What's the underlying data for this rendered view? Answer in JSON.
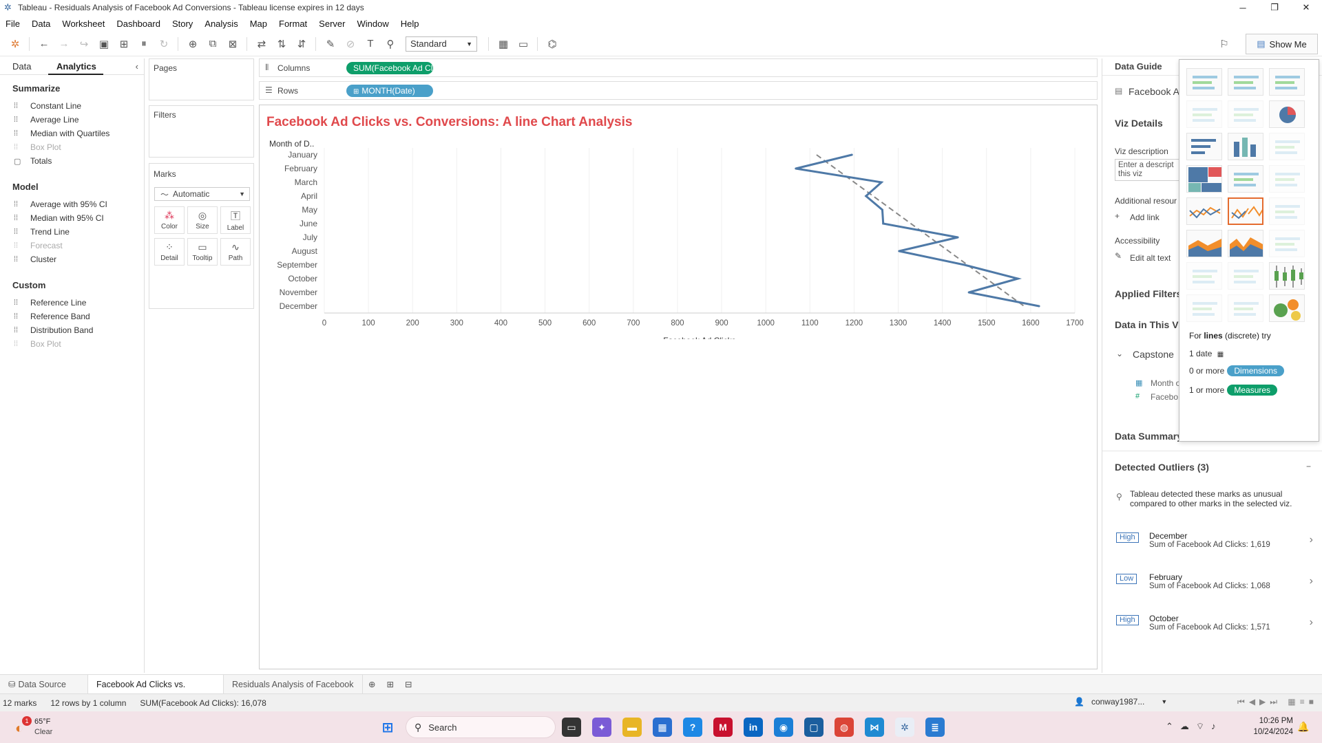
{
  "window": {
    "title": "Tableau - Residuals Analysis of Facebook Ad Conversions - Tableau license expires in 12 days"
  },
  "menu": [
    "File",
    "Data",
    "Worksheet",
    "Dashboard",
    "Story",
    "Analysis",
    "Map",
    "Format",
    "Server",
    "Window",
    "Help"
  ],
  "toolbar": {
    "fit_select": "Standard",
    "show_me_label": "Show Me"
  },
  "left_panel": {
    "tabs": [
      "Data",
      "Analytics"
    ],
    "active_tab": "Analytics",
    "sections": [
      {
        "title": "Summarize",
        "items": [
          {
            "label": "Constant Line",
            "enabled": true
          },
          {
            "label": "Average Line",
            "enabled": true
          },
          {
            "label": "Median with Quartiles",
            "enabled": true
          },
          {
            "label": "Box Plot",
            "enabled": false
          },
          {
            "label": "Totals",
            "enabled": true
          }
        ]
      },
      {
        "title": "Model",
        "items": [
          {
            "label": "Average with 95% CI",
            "enabled": true
          },
          {
            "label": "Median with 95% CI",
            "enabled": true
          },
          {
            "label": "Trend Line",
            "enabled": true
          },
          {
            "label": "Forecast",
            "enabled": false
          },
          {
            "label": "Cluster",
            "enabled": true
          }
        ]
      },
      {
        "title": "Custom",
        "items": [
          {
            "label": "Reference Line",
            "enabled": true
          },
          {
            "label": "Reference Band",
            "enabled": true
          },
          {
            "label": "Distribution Band",
            "enabled": true
          },
          {
            "label": "Box Plot",
            "enabled": false
          }
        ]
      }
    ]
  },
  "shelves": {
    "pages_label": "Pages",
    "filters_label": "Filters",
    "marks_label": "Marks",
    "mark_type": "Automatic",
    "mark_buttons": [
      "Color",
      "Size",
      "Label",
      "Detail",
      "Tooltip",
      "Path"
    ],
    "columns_label": "Columns",
    "rows_label": "Rows",
    "columns_pill": "SUM(Facebook Ad Cl..",
    "rows_pill": "MONTH(Date)"
  },
  "viz": {
    "title": "Facebook Ad Clicks vs. Conversions: A line Chart Analysis"
  },
  "chart_data": {
    "type": "line",
    "title": "Facebook Ad Clicks vs. Conversions: A line Chart Analysis",
    "row_header": "Month of D..",
    "xlabel": "Facebook Ad Clicks",
    "categories": [
      "January",
      "February",
      "March",
      "April",
      "May",
      "June",
      "July",
      "August",
      "September",
      "October",
      "November",
      "December"
    ],
    "series": [
      {
        "values": [
          1195,
          1068,
          1262,
          1227,
          1264,
          1266,
          1435,
          1302,
          1450,
          1571,
          1460,
          1619
        ],
        "color": "#4e79a7"
      }
    ],
    "trend_line": {
      "start": 1115,
      "end": 1585,
      "style": "dashed",
      "color": "#888888"
    },
    "xticks": [
      0,
      100,
      200,
      300,
      400,
      500,
      600,
      700,
      800,
      900,
      1000,
      1100,
      1200,
      1300,
      1400,
      1500,
      1600,
      1700
    ],
    "xlim": [
      0,
      1700
    ],
    "grid": "vertical"
  },
  "data_guide": {
    "title": "Data Guide",
    "sheet_name": "Facebook A",
    "viz_details": "Viz Details",
    "viz_description_label": "Viz description",
    "viz_description_placeholder": "Enter a descript this viz",
    "additional_resources": "Additional resour",
    "add_link": "Add link",
    "accessibility": "Accessibility",
    "edit_alt_text": "Edit alt text",
    "applied_filters": "Applied Filters",
    "data_in_viz": "Data in This Vi",
    "datasource": "Capstone",
    "fields": [
      "Month o",
      "Facebo"
    ],
    "data_summary": "Data Summary",
    "detected_outliers": "Detected Outliers (3)",
    "outlier_note": "Tableau detected these marks as unusual compared to other marks in the selected viz.",
    "outliers": [
      {
        "level": "High",
        "month": "December",
        "detail": "Sum of Facebook Ad Clicks: 1,619"
      },
      {
        "level": "Low",
        "month": "February",
        "detail": "Sum of Facebook Ad Clicks: 1,068"
      },
      {
        "level": "High",
        "month": "October",
        "detail": "Sum of Facebook Ad Clicks: 1,571"
      }
    ]
  },
  "show_me": {
    "hint_prefix": "For",
    "hint_bold": "lines",
    "hint_suffix": "(discrete) try",
    "req_date": "1 date",
    "req_dim_prefix": "0 or more",
    "req_dim": "Dimensions",
    "req_meas_prefix": "1 or more",
    "req_meas": "Measures"
  },
  "sheets": {
    "data_source": "Data Source",
    "tabs": [
      "Facebook Ad Clicks vs. Conver...",
      "Residuals Analysis of Facebook ..."
    ],
    "active": 0
  },
  "status": {
    "marks": "12 marks",
    "dims": "12 rows by 1 column",
    "sum": "SUM(Facebook Ad Clicks): 16,078",
    "user": "conway1987..."
  },
  "taskbar": {
    "weather_temp": "65°F",
    "weather_desc": "Clear",
    "weather_badge": "1",
    "search_placeholder": "Search",
    "time": "10:26 PM",
    "date": "10/24/2024"
  },
  "colors": {
    "accent_green": "#0e9e6a",
    "pill_blue": "#4aa0c9",
    "title_red": "#e0494c",
    "line_blue": "#4e79a7"
  }
}
